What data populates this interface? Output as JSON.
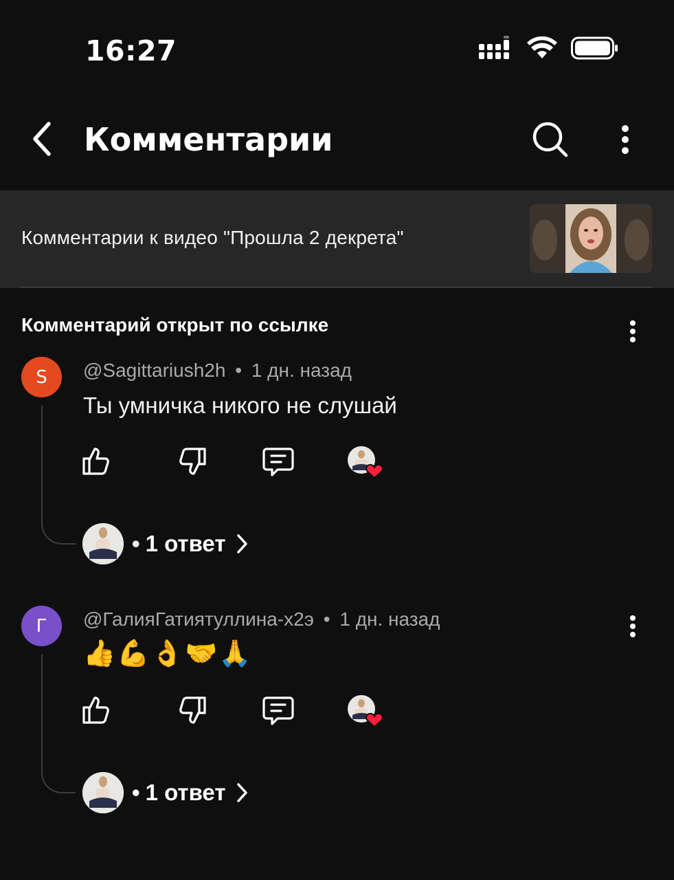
{
  "status_bar": {
    "time": "16:27",
    "icons": [
      "signal-icon",
      "wifi-icon",
      "battery-icon"
    ]
  },
  "header": {
    "title": "Комментарии",
    "icons": [
      "back-arrow-icon",
      "search-icon",
      "more-vertical-icon"
    ]
  },
  "video_banner": {
    "text": "Комментарии к видео \"Прошла 2 декрета\""
  },
  "section": {
    "label": "Комментарий открыт по ссылке"
  },
  "comments": [
    {
      "avatar_letter": "S",
      "avatar_color": "#e4491f",
      "author": "@Sagittariush2h",
      "separator": "•",
      "time": "1 дн. назад",
      "text": "Ты умничка никого не слушай",
      "replies": {
        "bullet": "•",
        "label": "1 ответ"
      }
    },
    {
      "avatar_letter": "Г",
      "avatar_color": "#7a4fc9",
      "author": "@ГалияГатиятуллина-х2э",
      "separator": "•",
      "time": "1 дн. назад",
      "text": "👍💪👌🤝🙏",
      "replies": {
        "bullet": "•",
        "label": "1 ответ"
      }
    }
  ],
  "colors": {
    "background": "#0f0f0f",
    "banner": "#272727",
    "meta_text": "#aaaaaa",
    "heart": "#ff1f3d"
  }
}
